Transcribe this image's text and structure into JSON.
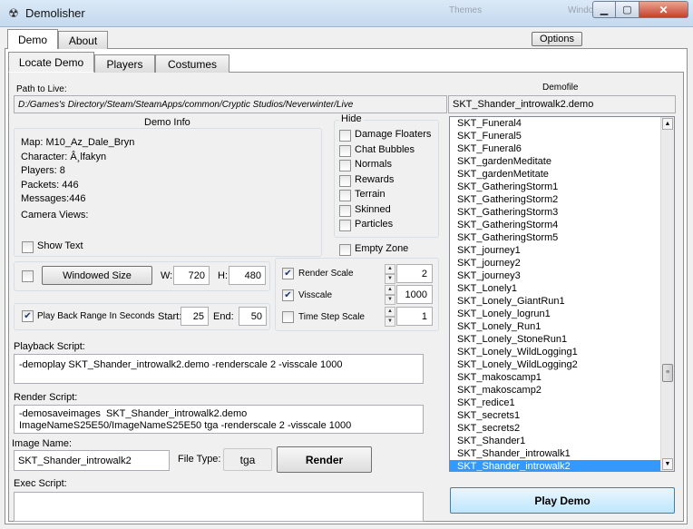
{
  "window": {
    "title": "Demolisher",
    "app_icon": "demolisher-app-icon",
    "ghost_text_1": "Themes",
    "ghost_text_2": "Windows",
    "min_symbol": "▁",
    "max_symbol": "▢",
    "close_symbol": "✕"
  },
  "tabs": {
    "main": [
      {
        "label": "Demo",
        "active": true
      },
      {
        "label": "About",
        "active": false
      }
    ],
    "sub": [
      {
        "label": "Locate Demo",
        "active": true
      },
      {
        "label": "Players",
        "active": false
      },
      {
        "label": "Costumes",
        "active": false
      }
    ]
  },
  "options_button": "Options",
  "path": {
    "label": "Path to Live:",
    "value": "D:/Games's Directory/Steam/SteamApps/common/Cryptic Studios/Neverwinter/Live"
  },
  "demofile": {
    "label": "Demofile",
    "value": "SKT_Shander_introwalk2.demo"
  },
  "demo_info": {
    "title": "Demo Info",
    "lines": [
      "Map: M10_Az_Dale_Bryn",
      "Character: Â¸lfakyn",
      "Players: 8",
      "Packets: 446",
      "Messages:446",
      "Camera Views:"
    ],
    "show_text": {
      "label": "Show Text",
      "checked": false
    }
  },
  "hide": {
    "title": "Hide",
    "items": [
      {
        "label": "Damage Floaters",
        "checked": false
      },
      {
        "label": "Chat Bubbles",
        "checked": false
      },
      {
        "label": "Normals",
        "checked": false
      },
      {
        "label": "Rewards",
        "checked": false
      },
      {
        "label": "Terrain",
        "checked": false
      },
      {
        "label": "Skinned",
        "checked": false
      },
      {
        "label": "Particles",
        "checked": false
      }
    ],
    "empty_zone": {
      "label": "Empty Zone",
      "checked": false
    }
  },
  "windowed": {
    "checked": false,
    "button": "Windowed Size",
    "w_label": "W:",
    "w_value": "720",
    "h_label": "H:",
    "h_value": "480"
  },
  "range": {
    "checked": true,
    "label": "Play Back Range In Seconds",
    "start_label": "Start:",
    "start_value": "25",
    "end_label": "End:",
    "end_value": "50"
  },
  "scales": [
    {
      "label": "Render Scale",
      "checked": true,
      "value": "2"
    },
    {
      "label": "Visscale",
      "checked": true,
      "value": "1000"
    },
    {
      "label": "Time Step Scale",
      "checked": false,
      "value": "1"
    }
  ],
  "playback_script": {
    "label": "Playback Script:",
    "value": "-demoplay SKT_Shander_introwalk2.demo -renderscale 2 -visscale 1000"
  },
  "render_script": {
    "label": "Render Script:",
    "value": "-demosaveimages  SKT_Shander_introwalk2.demo\nImageNameS25E50/ImageNameS25E50 tga -renderscale 2 -visscale 1000"
  },
  "image_name": {
    "label": "Image Name:",
    "value": "SKT_Shander_introwalk2"
  },
  "file_type": {
    "label": "File Type:",
    "value": "tga"
  },
  "render_button": "Render",
  "exec_script": {
    "label": "Exec Script:",
    "value": ""
  },
  "play_button": "Play Demo",
  "demo_list": {
    "items": [
      "SKT_Funeral4",
      "SKT_Funeral5",
      "SKT_Funeral6",
      "SKT_gardenMeditate",
      "SKT_gardenMetitate",
      "SKT_GatheringStorm1",
      "SKT_GatheringStorm2",
      "SKT_GatheringStorm3",
      "SKT_GatheringStorm4",
      "SKT_GatheringStorm5",
      "SKT_journey1",
      "SKT_journey2",
      "SKT_journey3",
      "SKT_Lonely1",
      "SKT_Lonely_GiantRun1",
      "SKT_Lonely_logrun1",
      "SKT_Lonely_Run1",
      "SKT_Lonely_StoneRun1",
      "SKT_Lonely_WildLogging1",
      "SKT_Lonely_WildLogging2",
      "SKT_makoscamp1",
      "SKT_makoscamp2",
      "SKT_redice1",
      "SKT_secrets1",
      "SKT_secrets2",
      "SKT_Shander1",
      "SKT_Shander_introwalk1",
      "SKT_Shander_introwalk2"
    ],
    "selected_index": 27,
    "scroll_up": "▲",
    "scroll_down": "▼",
    "thumb_grip": "≡"
  },
  "colors": {
    "selection": "#3399ff",
    "titlebar": "#c4d9ee",
    "close": "#c7402a"
  }
}
